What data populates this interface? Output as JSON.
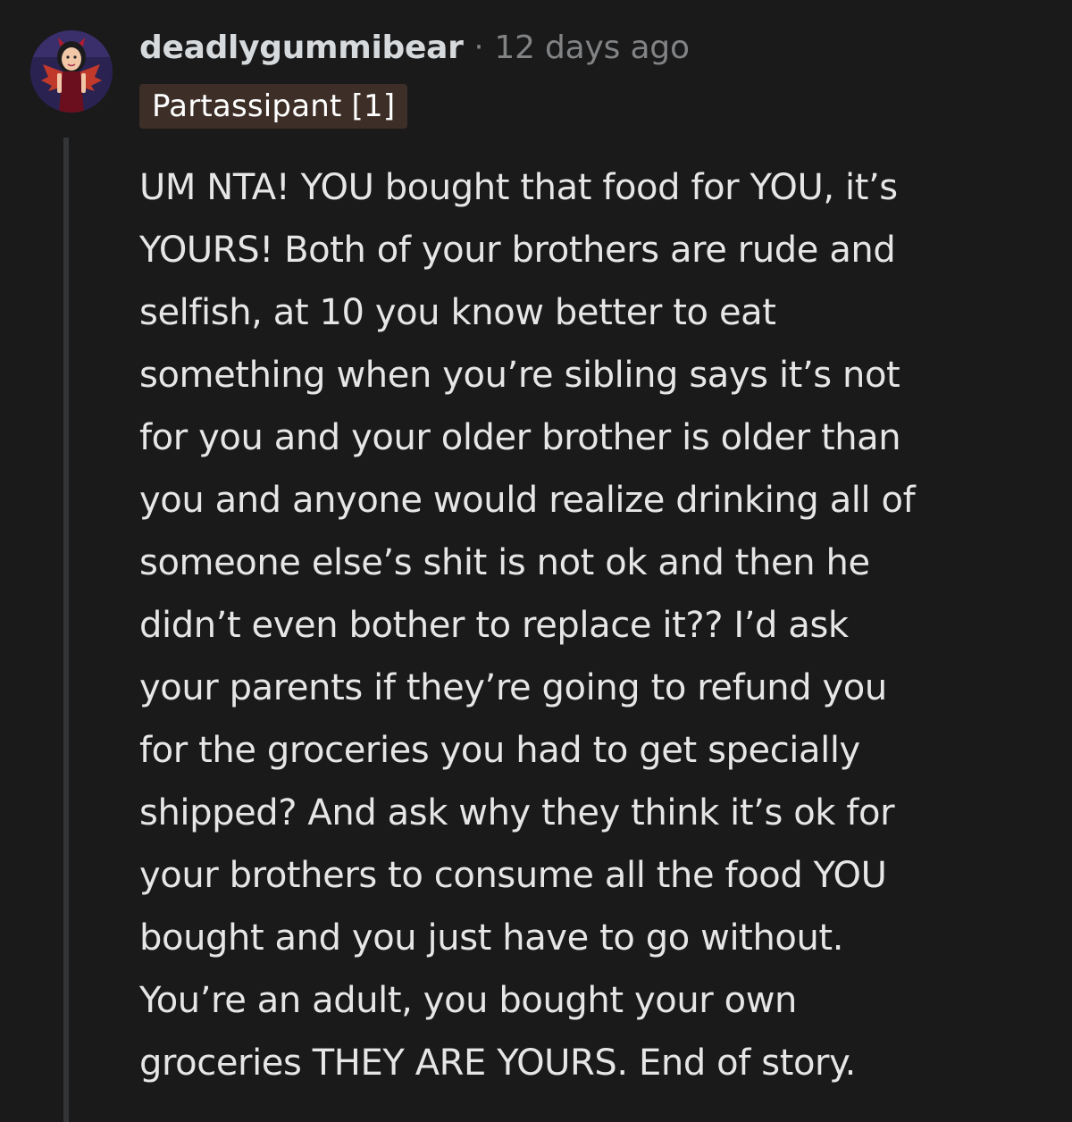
{
  "comment": {
    "username": "deadlygummibear",
    "separator": "·",
    "timestamp": "12 days ago",
    "flair": "Partassipant [1]",
    "body_lines": [
      "UM NTA! YOU bought that food for YOU, it’s",
      "YOURS! Both of your brothers are rude and",
      "selfish, at 10 you know better to eat",
      "something when you’re sibling says it’s not",
      "for you and your older brother is older than",
      "you and anyone would realize drinking all of",
      "someone else’s shit is not ok and then he",
      "didn’t even bother to replace it?? I’d ask",
      "your parents if they’re going to refund you",
      "for the groceries you had to get specially",
      "shipped? And ask why they think it’s ok for",
      "your brothers to consume all the food YOU",
      "bought and you just have to go without.",
      "You’re an adult, you bought your own",
      "groceries THEY ARE YOURS. End of story."
    ]
  },
  "colors": {
    "background": "#1a1a1b",
    "text": "#d7dadc",
    "muted": "#818384",
    "flair_bg": "#3d2f28",
    "thread_line": "#343536"
  }
}
